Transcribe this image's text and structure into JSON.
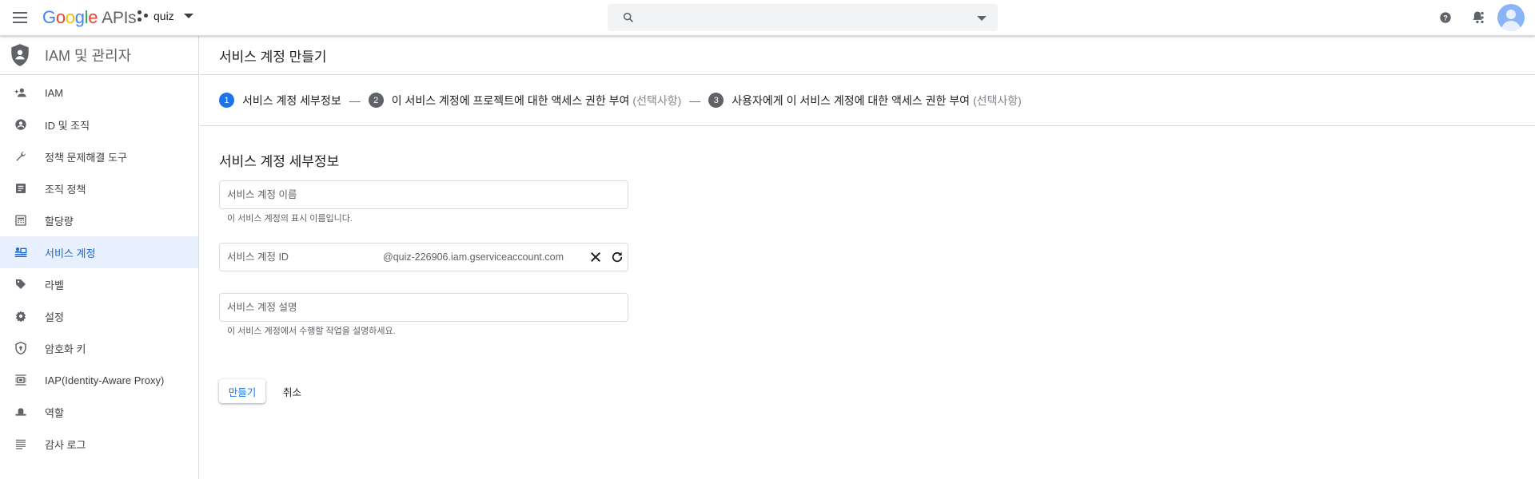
{
  "topbar": {
    "logo": {
      "letters": [
        "G",
        "o",
        "o",
        "g",
        "l",
        "e"
      ],
      "suffix": "APIs"
    },
    "project_name": "quiz",
    "search": {
      "value": "",
      "placeholder": ""
    },
    "icons": [
      "menu-icon",
      "project-dots-icon",
      "search-icon",
      "help-icon",
      "notifications-icon",
      "more-vert-icon",
      "account-avatar"
    ]
  },
  "sidebar": {
    "title": "IAM 및 관리자",
    "items": [
      {
        "label": "IAM",
        "icon": "person-add-icon",
        "active": false
      },
      {
        "label": "ID 및 조직",
        "icon": "account-circle-icon",
        "active": false
      },
      {
        "label": "정책 문제해결 도구",
        "icon": "wrench-icon",
        "active": false
      },
      {
        "label": "조직 정책",
        "icon": "article-icon",
        "active": false
      },
      {
        "label": "할당량",
        "icon": "calendar-grid-icon",
        "active": false
      },
      {
        "label": "서비스 계정",
        "icon": "service-account-icon",
        "active": true
      },
      {
        "label": "라벨",
        "icon": "label-tag-icon",
        "active": false
      },
      {
        "label": "설정",
        "icon": "gear-icon",
        "active": false
      },
      {
        "label": "암호화 키",
        "icon": "security-shield-icon",
        "active": false
      },
      {
        "label": "IAP(Identity-Aware Proxy)",
        "icon": "proxy-icon",
        "active": false
      },
      {
        "label": "역할",
        "icon": "role-hat-icon",
        "active": false
      },
      {
        "label": "감사 로그",
        "icon": "list-lines-icon",
        "active": false
      }
    ]
  },
  "main": {
    "title": "서비스 계정 만들기",
    "steps": [
      {
        "number": "1",
        "label": "서비스 계정 세부정보",
        "optional": "",
        "active": true
      },
      {
        "number": "2",
        "label": "이 서비스 계정에 프로젝트에 대한 액세스 권한 부여",
        "optional": "(선택사항)",
        "active": false
      },
      {
        "number": "3",
        "label": "사용자에게 이 서비스 계정에 대한 액세스 권한 부여",
        "optional": "(선택사항)",
        "active": false
      }
    ],
    "step_separator": "—",
    "section_title": "서비스 계정 세부정보",
    "fields": {
      "name": {
        "placeholder": "서비스 계정 이름",
        "value": "",
        "hint": "이 서비스 계정의 표시 이름입니다."
      },
      "id": {
        "placeholder": "서비스 계정 ID",
        "value": "",
        "suffix": "@quiz-226906.iam.gserviceaccount.com"
      },
      "description": {
        "placeholder": "서비스 계정 설명",
        "value": "",
        "hint": "이 서비스 계정에서 수행할 작업을 설명하세요."
      }
    },
    "buttons": {
      "create": "만들기",
      "cancel": "취소"
    }
  },
  "colors": {
    "accent": "#1a73e8",
    "active_bg": "#e8f0fe",
    "active_text": "#1967d2",
    "border": "#dadce0"
  }
}
